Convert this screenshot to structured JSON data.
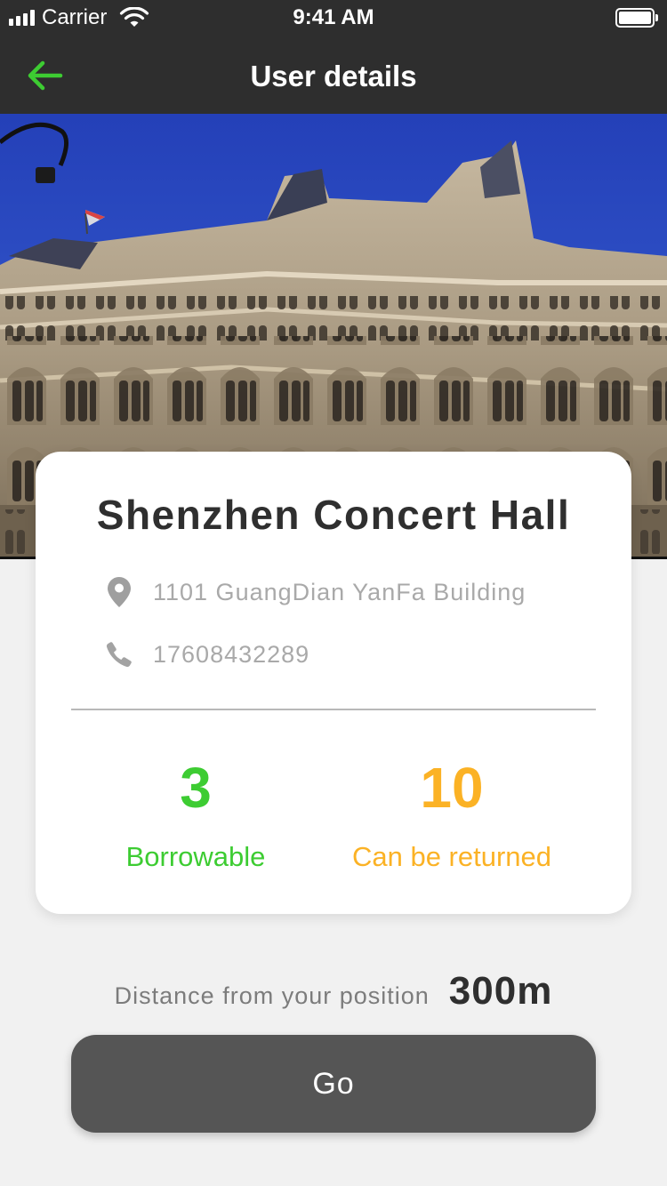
{
  "status_bar": {
    "carrier": "Carrier",
    "time": "9:41 AM"
  },
  "nav": {
    "title": "User details"
  },
  "venue": {
    "name": "Shenzhen Concert Hall",
    "address": "1101 GuangDian YanFa Building",
    "phone": "17608432289"
  },
  "stats": {
    "borrowable_count": "3",
    "borrowable_label": "Borrowable",
    "returnable_count": "10",
    "returnable_label": "Can be returned"
  },
  "distance": {
    "label": "Distance from your position",
    "value": "300m"
  },
  "go_button": {
    "label": "Go"
  },
  "colors": {
    "bar_background": "#2e2e2e",
    "accent_green": "#3dcc32",
    "accent_orange": "#fbb225",
    "button_background": "#555555",
    "page_background": "#f1f1f1"
  },
  "icons": {
    "back": "arrow-left-icon",
    "address": "location-pin-icon",
    "phone": "phone-icon",
    "wifi": "wifi-icon",
    "battery": "battery-icon",
    "signal": "signal-icon"
  }
}
